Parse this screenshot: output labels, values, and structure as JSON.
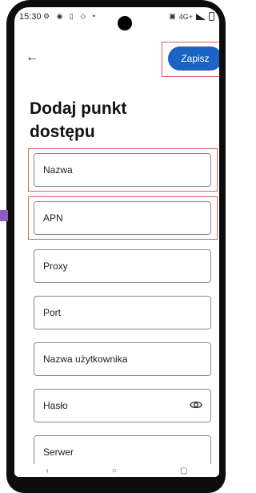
{
  "status_bar": {
    "time": "15:30",
    "left_icons": "⚙ ◉ ▯ ◇ •",
    "network": "4G+"
  },
  "header": {
    "back_icon": "arrow-left-icon",
    "save_label": "Zapisz"
  },
  "title": "Dodaj punkt dostępu",
  "fields": [
    {
      "label": "Nazwa"
    },
    {
      "label": "APN"
    },
    {
      "label": "Proxy"
    },
    {
      "label": "Port"
    },
    {
      "label": "Nazwa użytkownika"
    },
    {
      "label": "Hasło",
      "icon": "eye-icon"
    },
    {
      "label": "Serwer"
    }
  ],
  "nav": {
    "back": "‹",
    "home": "○",
    "recents": "▢"
  },
  "colors": {
    "accent": "#1d63c4",
    "highlight": "#e06060"
  }
}
